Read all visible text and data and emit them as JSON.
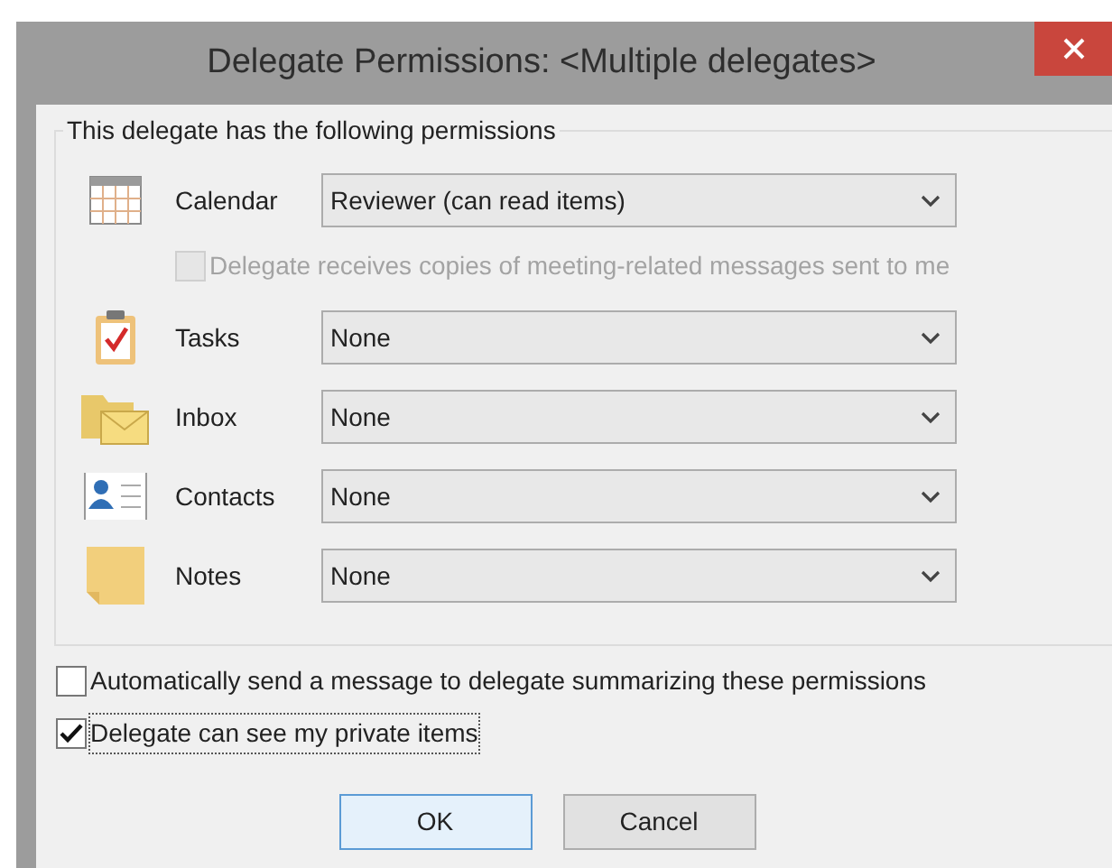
{
  "window": {
    "title": "Delegate Permissions: <Multiple delegates>"
  },
  "permissions": {
    "heading": "This delegate has the following permissions",
    "folders": [
      {
        "kind": "calendar",
        "label": "Calendar",
        "value": "Reviewer (can read items)"
      },
      {
        "kind": "tasks",
        "label": "Tasks",
        "value": "None"
      },
      {
        "kind": "inbox",
        "label": "Inbox",
        "value": "None"
      },
      {
        "kind": "contacts",
        "label": "Contacts",
        "value": "None"
      },
      {
        "kind": "notes",
        "label": "Notes",
        "value": "None"
      }
    ],
    "meeting_copies": {
      "label": "Delegate receives copies of meeting-related messages sent to me",
      "checked": false,
      "disabled": true
    }
  },
  "options": [
    {
      "label": "Automatically send a message to delegate summarizing these permissions",
      "checked": false,
      "focused": false
    },
    {
      "label": "Delegate can see my private items",
      "checked": true,
      "focused": true
    }
  ],
  "buttons": [
    {
      "label": "OK",
      "default": true
    },
    {
      "label": "Cancel",
      "default": false
    }
  ]
}
